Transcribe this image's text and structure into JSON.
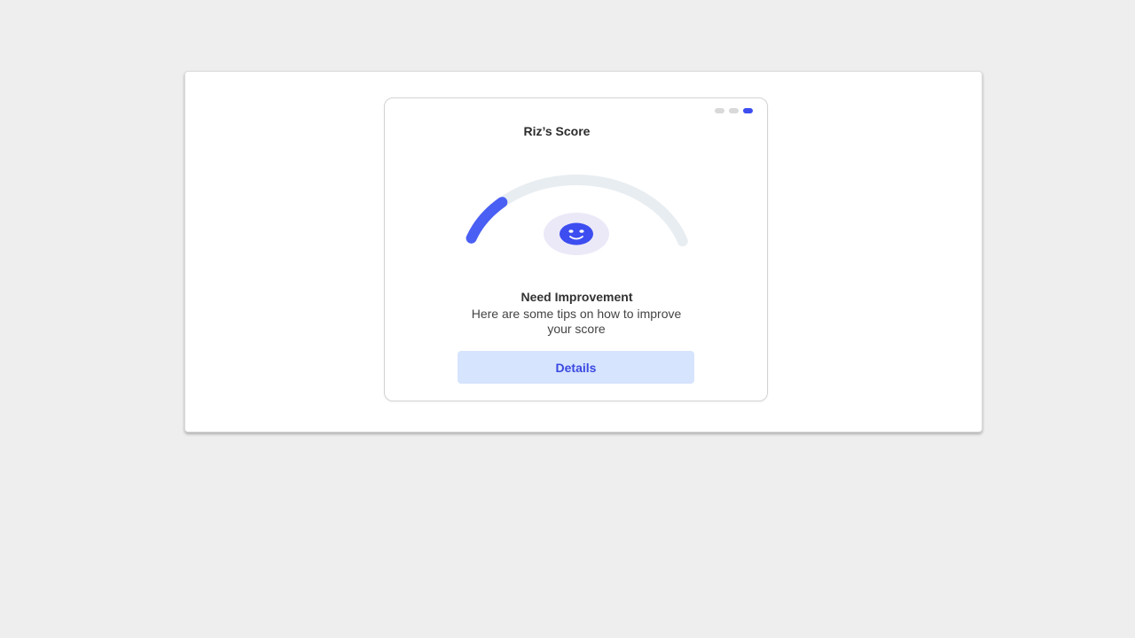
{
  "card": {
    "title": "Riz’s Score",
    "pager": {
      "count": 3,
      "active_index": 2
    }
  },
  "gauge": {
    "score_fraction": 0.2,
    "icon": "smiley-face-icon",
    "colors": {
      "fill": "#4a5ff3",
      "track": "#e8edf1",
      "icon_bg": "#ebe9f8",
      "icon": "#3d4df0"
    }
  },
  "status": {
    "title": "Need Improvement",
    "description": "Here are some tips on how to improve your score"
  },
  "actions": {
    "details_label": "Details"
  },
  "colors": {
    "background": "#eeeeee",
    "accent": "#3d4df0",
    "button_bg": "#d6e4fd"
  }
}
